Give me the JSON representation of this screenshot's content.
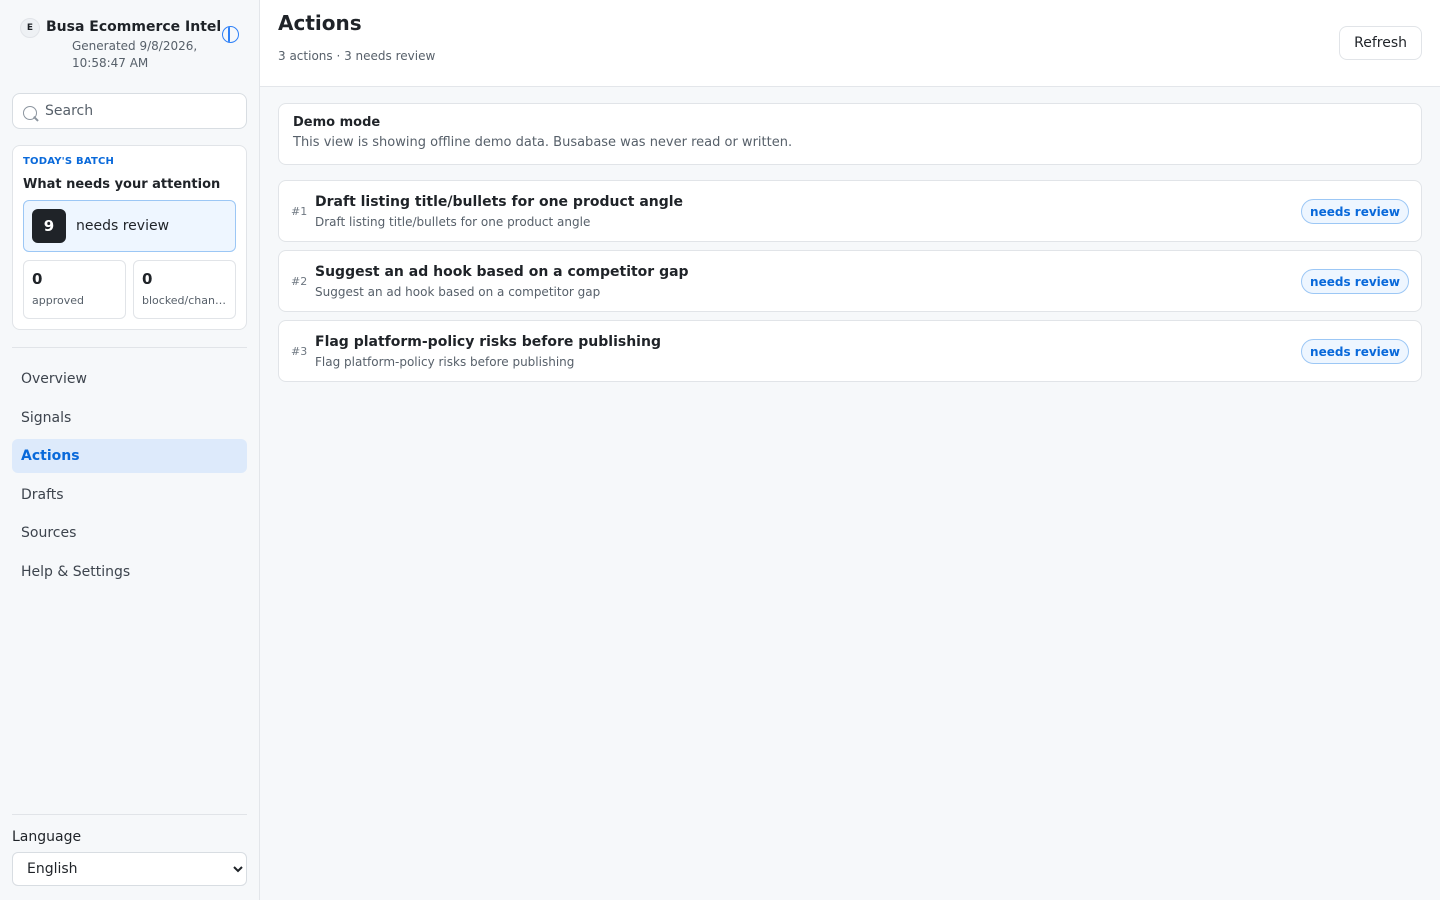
{
  "sidebar": {
    "brand_initial": "E",
    "brand_name": "Busa Ecommerce Intel",
    "generated": "Generated 9/8/2026, 10:58:47 AM",
    "search_placeholder": "Search",
    "batch": {
      "kicker": "TODAY'S BATCH",
      "title": "What needs your attention",
      "review_count": "9",
      "review_label": "needs review",
      "approved_count": "0",
      "approved_label": "approved",
      "blocked_count": "0",
      "blocked_label": "blocked/changes"
    },
    "nav": [
      {
        "label": "Overview"
      },
      {
        "label": "Signals"
      },
      {
        "label": "Actions"
      },
      {
        "label": "Drafts"
      },
      {
        "label": "Sources"
      },
      {
        "label": "Help & Settings"
      }
    ],
    "language_label": "Language",
    "language_value": "English"
  },
  "header": {
    "title": "Actions",
    "subtitle": "3 actions · 3 needs review",
    "refresh_label": "Refresh"
  },
  "notice": {
    "title": "Demo mode",
    "text": "This view is showing offline demo data. Busabase was never read or written."
  },
  "actions": [
    {
      "index": "#1",
      "title": "Draft listing title/bullets for one product angle",
      "subtitle": "Draft listing title/bullets for one product angle",
      "status": "needs review"
    },
    {
      "index": "#2",
      "title": "Suggest an ad hook based on a competitor gap",
      "subtitle": "Suggest an ad hook based on a competitor gap",
      "status": "needs review"
    },
    {
      "index": "#3",
      "title": "Flag platform-policy risks before publishing",
      "subtitle": "Flag platform-policy risks before publishing",
      "status": "needs review"
    }
  ],
  "colors": {
    "accent": "#0969da",
    "active_bg": "#ddeafb"
  }
}
